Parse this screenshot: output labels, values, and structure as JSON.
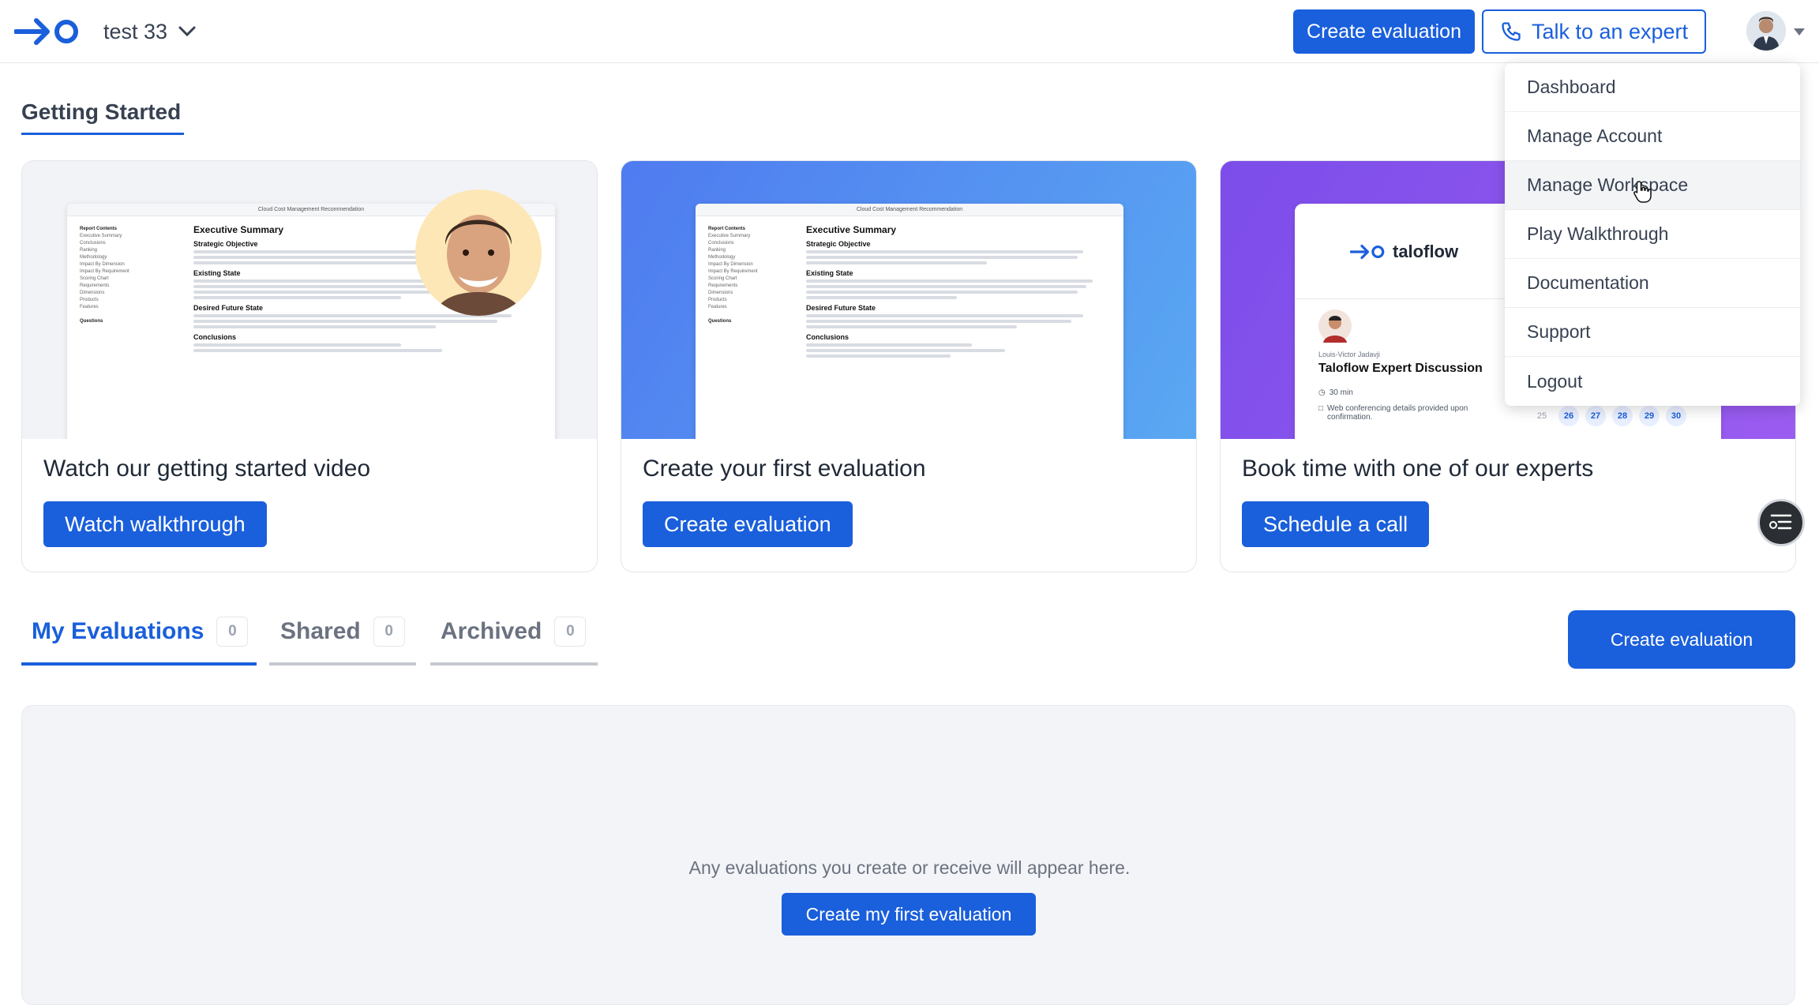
{
  "header": {
    "workspace_name": "test 33",
    "create_label": "Create evaluation",
    "talk_label": "Talk to an expert",
    "brand_color": "#1a5fdb"
  },
  "menu": {
    "items": [
      "Dashboard",
      "Manage Account",
      "Manage Workspace",
      "Play Walkthrough",
      "Documentation",
      "Support",
      "Logout"
    ],
    "hovered": "Manage Workspace"
  },
  "getting_started": {
    "title": "Getting Started",
    "cards": [
      {
        "title": "Watch our getting started video",
        "button": "Watch walkthrough"
      },
      {
        "title": "Create your first evaluation",
        "button": "Create evaluation"
      },
      {
        "title": "Book time with one of our experts",
        "button": "Schedule a call"
      }
    ],
    "doc_preview": {
      "window_title": "Cloud Cost Management Recommendation",
      "sidebar": [
        "Report Contents",
        "Executive Summary",
        "Conclusions",
        "Ranking",
        "Methodology",
        "Impact By Dimension",
        "Impact By Requirement",
        "Scoring Chart",
        "Requirements",
        "Dimensions",
        "Products",
        "Features"
      ],
      "questions": "Questions",
      "heading": "Executive Summary",
      "sections": [
        "Strategic Objective",
        "Existing State",
        "Desired Future State",
        "Conclusions"
      ]
    },
    "booking_preview": {
      "brand": "taloflow",
      "host": "Louis-Victor Jadavji",
      "event": "Taloflow Expert Discussion",
      "duration": "30 min",
      "details": "Web conferencing details provided upon confirmation.",
      "dates": [
        "25",
        "26",
        "27",
        "28",
        "29",
        "30"
      ]
    }
  },
  "evaluations": {
    "tabs": [
      {
        "label": "My Evaluations",
        "count": "0"
      },
      {
        "label": "Shared",
        "count": "0"
      },
      {
        "label": "Archived",
        "count": "0"
      }
    ],
    "create_label": "Create evaluation",
    "empty_text": "Any evaluations you create or receive will appear here.",
    "empty_button": "Create my first evaluation"
  }
}
